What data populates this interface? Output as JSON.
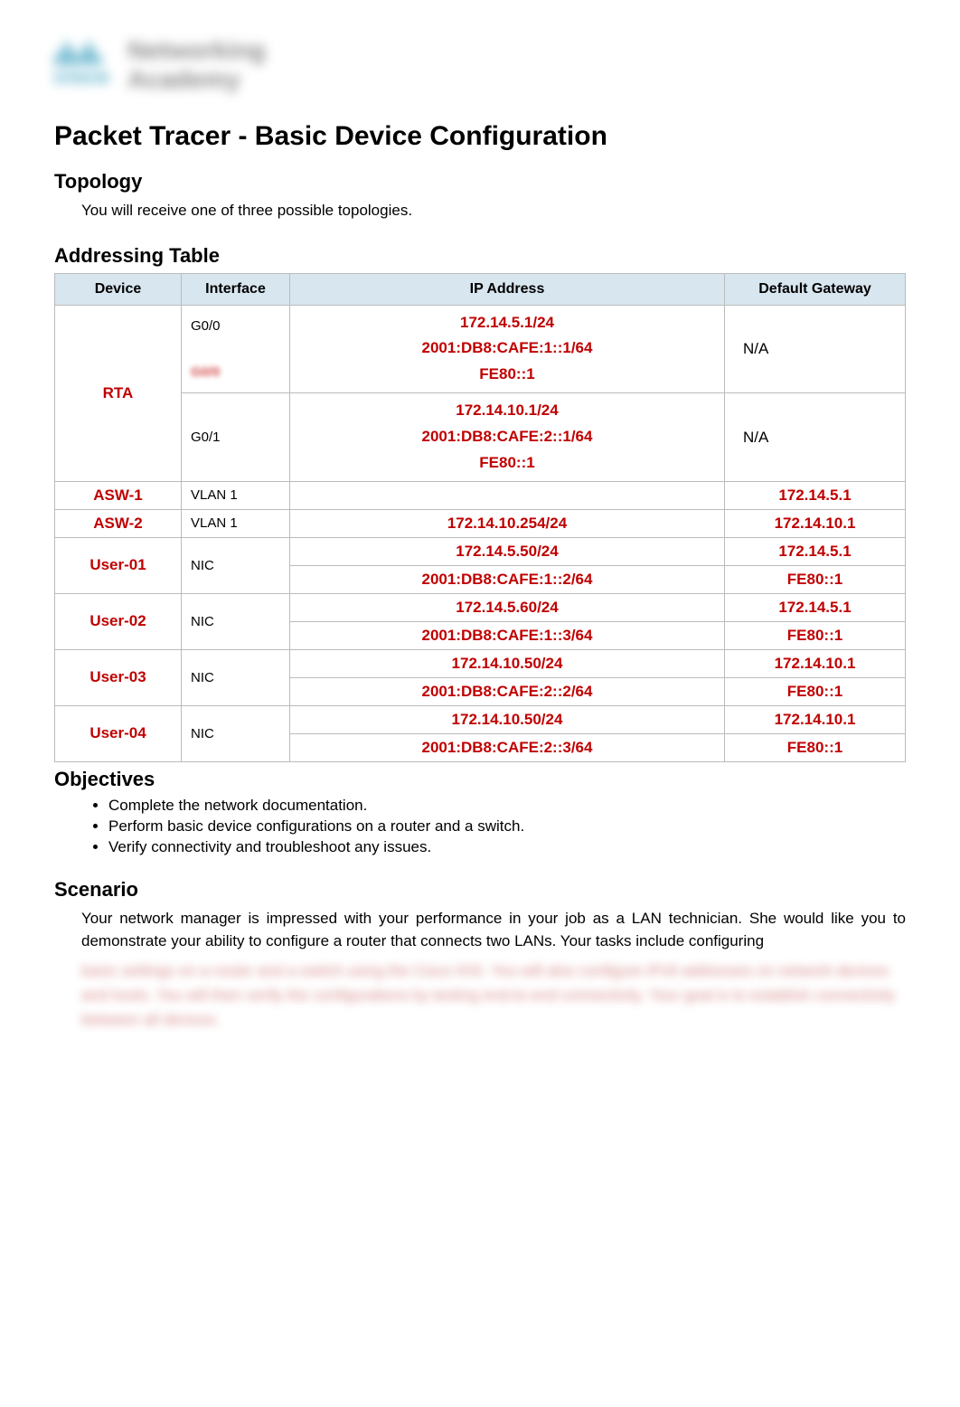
{
  "logo": {
    "brand": "cisco",
    "line1": "Networking",
    "line2": "Academy"
  },
  "title": "Packet Tracer - Basic Device Configuration",
  "sections": {
    "topology": {
      "heading": "Topology",
      "text": "You will receive one of three possible topologies."
    },
    "addressing": {
      "heading": "Addressing Table",
      "columns": [
        "Device",
        "Interface",
        "IP Address",
        "Default Gateway"
      ]
    },
    "objectives": {
      "heading": "Objectives",
      "items": [
        "Complete the network documentation.",
        "Perform basic device configurations on a router and a switch.",
        "Verify connectivity and troubleshoot any issues."
      ]
    },
    "scenario": {
      "heading": "Scenario",
      "text": "Your network manager is impressed with your performance in your job as a LAN technician. She would like you to demonstrate your ability to configure a router that connects two LANs. Your tasks include configuring",
      "blur_text": "basic settings on a router and a switch using the Cisco IOS. You will also configure IPv6 addresses on network devices and hosts. You will then verify the configurations by testing end-to-end connectivity. Your goal is to establish connectivity between all devices."
    }
  },
  "table_rows": {
    "rta": {
      "device": "RTA",
      "g00_iface": "G0/0",
      "g00_blur": "G0/0",
      "g00_ip1": "172.14.5.1/24",
      "g00_ip2": "2001:DB8:CAFE:1::1/64",
      "g00_ip3": "FE80::1",
      "g00_gw": "N/A",
      "g01_iface": "G0/1",
      "g01_ip1": "172.14.10.1/24",
      "g01_ip2": "2001:DB8:CAFE:2::1/64",
      "g01_ip3": "FE80::1",
      "g01_gw": "N/A"
    },
    "asw1": {
      "device": "ASW-1",
      "iface": "VLAN 1",
      "ip_blur": "",
      "gw": "172.14.5.1"
    },
    "asw2": {
      "device": "ASW-2",
      "iface": "VLAN 1",
      "ip": "172.14.10.254/24",
      "gw": "172.14.10.1"
    },
    "u01": {
      "device": "User-01",
      "iface": "NIC",
      "ip1": "172.14.5.50/24",
      "gw1": "172.14.5.1",
      "ip2": "2001:DB8:CAFE:1::2/64",
      "gw2": "FE80::1"
    },
    "u02": {
      "device": "User-02",
      "iface": "NIC",
      "ip1": "172.14.5.60/24",
      "gw1": "172.14.5.1",
      "ip2": "2001:DB8:CAFE:1::3/64",
      "gw2": "FE80::1"
    },
    "u03": {
      "device": "User-03",
      "iface": "NIC",
      "ip1": "172.14.10.50/24",
      "gw1": "172.14.10.1",
      "ip2": "2001:DB8:CAFE:2::2/64",
      "gw2": "FE80::1"
    },
    "u04": {
      "device": "User-04",
      "iface": "NIC",
      "ip1": "172.14.10.50/24",
      "gw1": "172.14.10.1",
      "ip2": "2001:DB8:CAFE:2::3/64",
      "gw2": "FE80::1"
    }
  }
}
